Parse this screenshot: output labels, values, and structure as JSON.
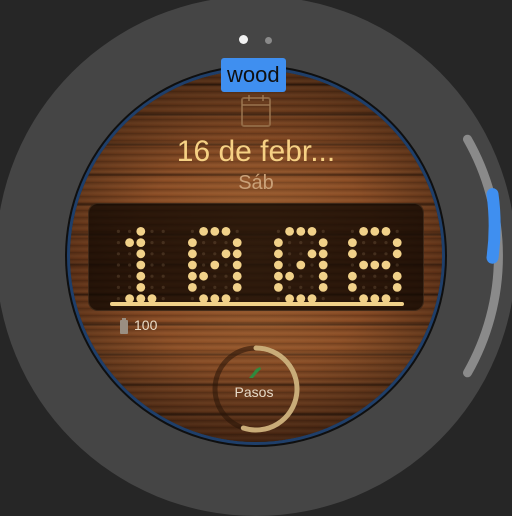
{
  "page_indicator": {
    "active_index": 0,
    "count": 2
  },
  "watchface_name": "wood",
  "date": "16 de febr...",
  "weekday": "Sáb",
  "time": {
    "hours": "10",
    "minutes": "08"
  },
  "battery": {
    "value": "100",
    "icon": "battery-icon"
  },
  "steps": {
    "label": "Pasos",
    "icon": "shoe-icon",
    "progress": 0.55
  },
  "scrollbar": {
    "icon": "scroll-indicator"
  },
  "colors": {
    "accent": "#3f8ff0",
    "digit": "#f1d189",
    "date_text": "#f6d184",
    "bezel": "#454545",
    "background": "#262626"
  }
}
